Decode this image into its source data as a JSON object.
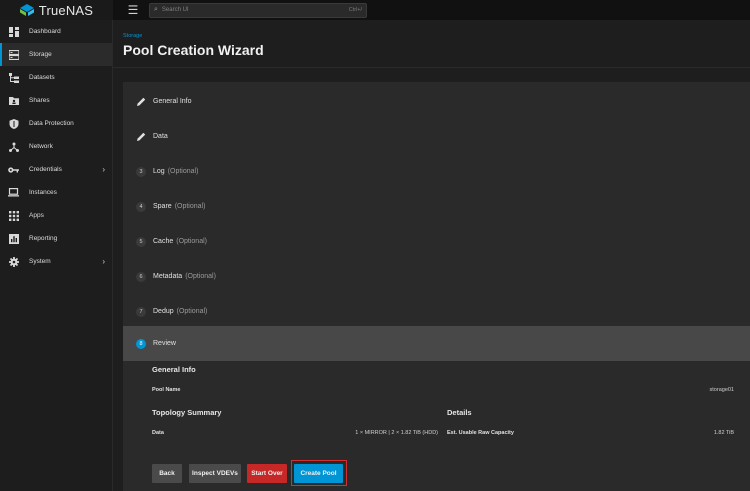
{
  "app": {
    "brand": "TrueNAS"
  },
  "search": {
    "placeholder": "Search UI",
    "shortcut": "Ctrl+/"
  },
  "sidebar": {
    "items": [
      {
        "label": "Dashboard",
        "icon": "dashboard-icon"
      },
      {
        "label": "Storage",
        "icon": "storage-icon",
        "active": true
      },
      {
        "label": "Datasets",
        "icon": "datasets-icon"
      },
      {
        "label": "Shares",
        "icon": "shares-icon"
      },
      {
        "label": "Data Protection",
        "icon": "shield-icon"
      },
      {
        "label": "Network",
        "icon": "network-icon"
      },
      {
        "label": "Credentials",
        "icon": "key-icon",
        "has_children": true
      },
      {
        "label": "Instances",
        "icon": "laptop-icon"
      },
      {
        "label": "Apps",
        "icon": "apps-grid-icon"
      },
      {
        "label": "Reporting",
        "icon": "reporting-icon"
      },
      {
        "label": "System",
        "icon": "gear-icon",
        "has_children": true
      }
    ]
  },
  "header": {
    "breadcrumb": "Storage",
    "title": "Pool Creation Wizard"
  },
  "wizard": {
    "steps": [
      {
        "number": "",
        "label": "General Info",
        "optional": "",
        "done": true
      },
      {
        "number": "",
        "label": "Data",
        "optional": "",
        "done": true
      },
      {
        "number": "3",
        "label": "Log",
        "optional": "(Optional)"
      },
      {
        "number": "4",
        "label": "Spare",
        "optional": "(Optional)"
      },
      {
        "number": "5",
        "label": "Cache",
        "optional": "(Optional)"
      },
      {
        "number": "6",
        "label": "Metadata",
        "optional": "(Optional)"
      },
      {
        "number": "7",
        "label": "Dedup",
        "optional": "(Optional)"
      },
      {
        "number": "8",
        "label": "Review",
        "optional": "",
        "active": true
      }
    ]
  },
  "review": {
    "general_info_title": "General Info",
    "pool_name_label": "Pool Name",
    "pool_name_value": "storage01",
    "topology_title": "Topology Summary",
    "data_label": "Data",
    "data_value": "1 × MIRROR | 2 × 1.82 TiB (HDD)",
    "details_title": "Details",
    "capacity_label": "Est. Usable Raw Capacity",
    "capacity_value": "1.82 TiB"
  },
  "buttons": {
    "back": "Back",
    "inspect": "Inspect VDEVs",
    "start_over": "Start Over",
    "create_pool": "Create Pool"
  },
  "colors": {
    "accent": "#0095d5",
    "danger": "#c62828",
    "highlight": "#d32f2f"
  }
}
